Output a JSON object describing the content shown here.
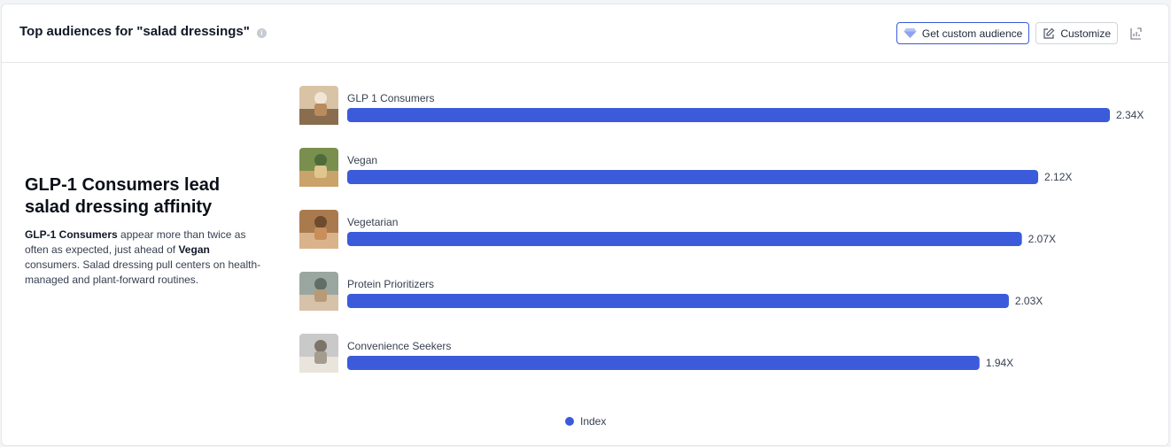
{
  "header": {
    "title": "Top audiences for \"salad dressings\"",
    "get_custom_audience_label": "Get custom audience",
    "customize_label": "Customize"
  },
  "insight": {
    "title": "GLP-1 Consumers lead salad dressing affinity",
    "body_bold_1": "GLP-1 Consumers",
    "body_text_1": " appear more than twice as often as expected, just ahead of ",
    "body_bold_2": "Vegan",
    "body_text_2": " consumers. Salad dressing pull centers on health-managed and plant-forward routines."
  },
  "colors": {
    "bar": "#3b5bdb",
    "accent_border": "#3b5bdb"
  },
  "chart_data": {
    "type": "bar",
    "orientation": "horizontal",
    "categories": [
      "GLP 1 Consumers",
      "Vegan",
      "Vegetarian",
      "Protein Prioritizers",
      "Convenience Seekers"
    ],
    "series": [
      {
        "name": "Index",
        "values": [
          2.34,
          2.12,
          2.07,
          2.03,
          1.94
        ]
      }
    ],
    "value_labels": [
      "2.34X",
      "2.12X",
      "2.07X",
      "2.03X",
      "1.94X"
    ],
    "xlim": [
      0,
      2.34
    ],
    "legend": "bottom",
    "grid": false
  }
}
